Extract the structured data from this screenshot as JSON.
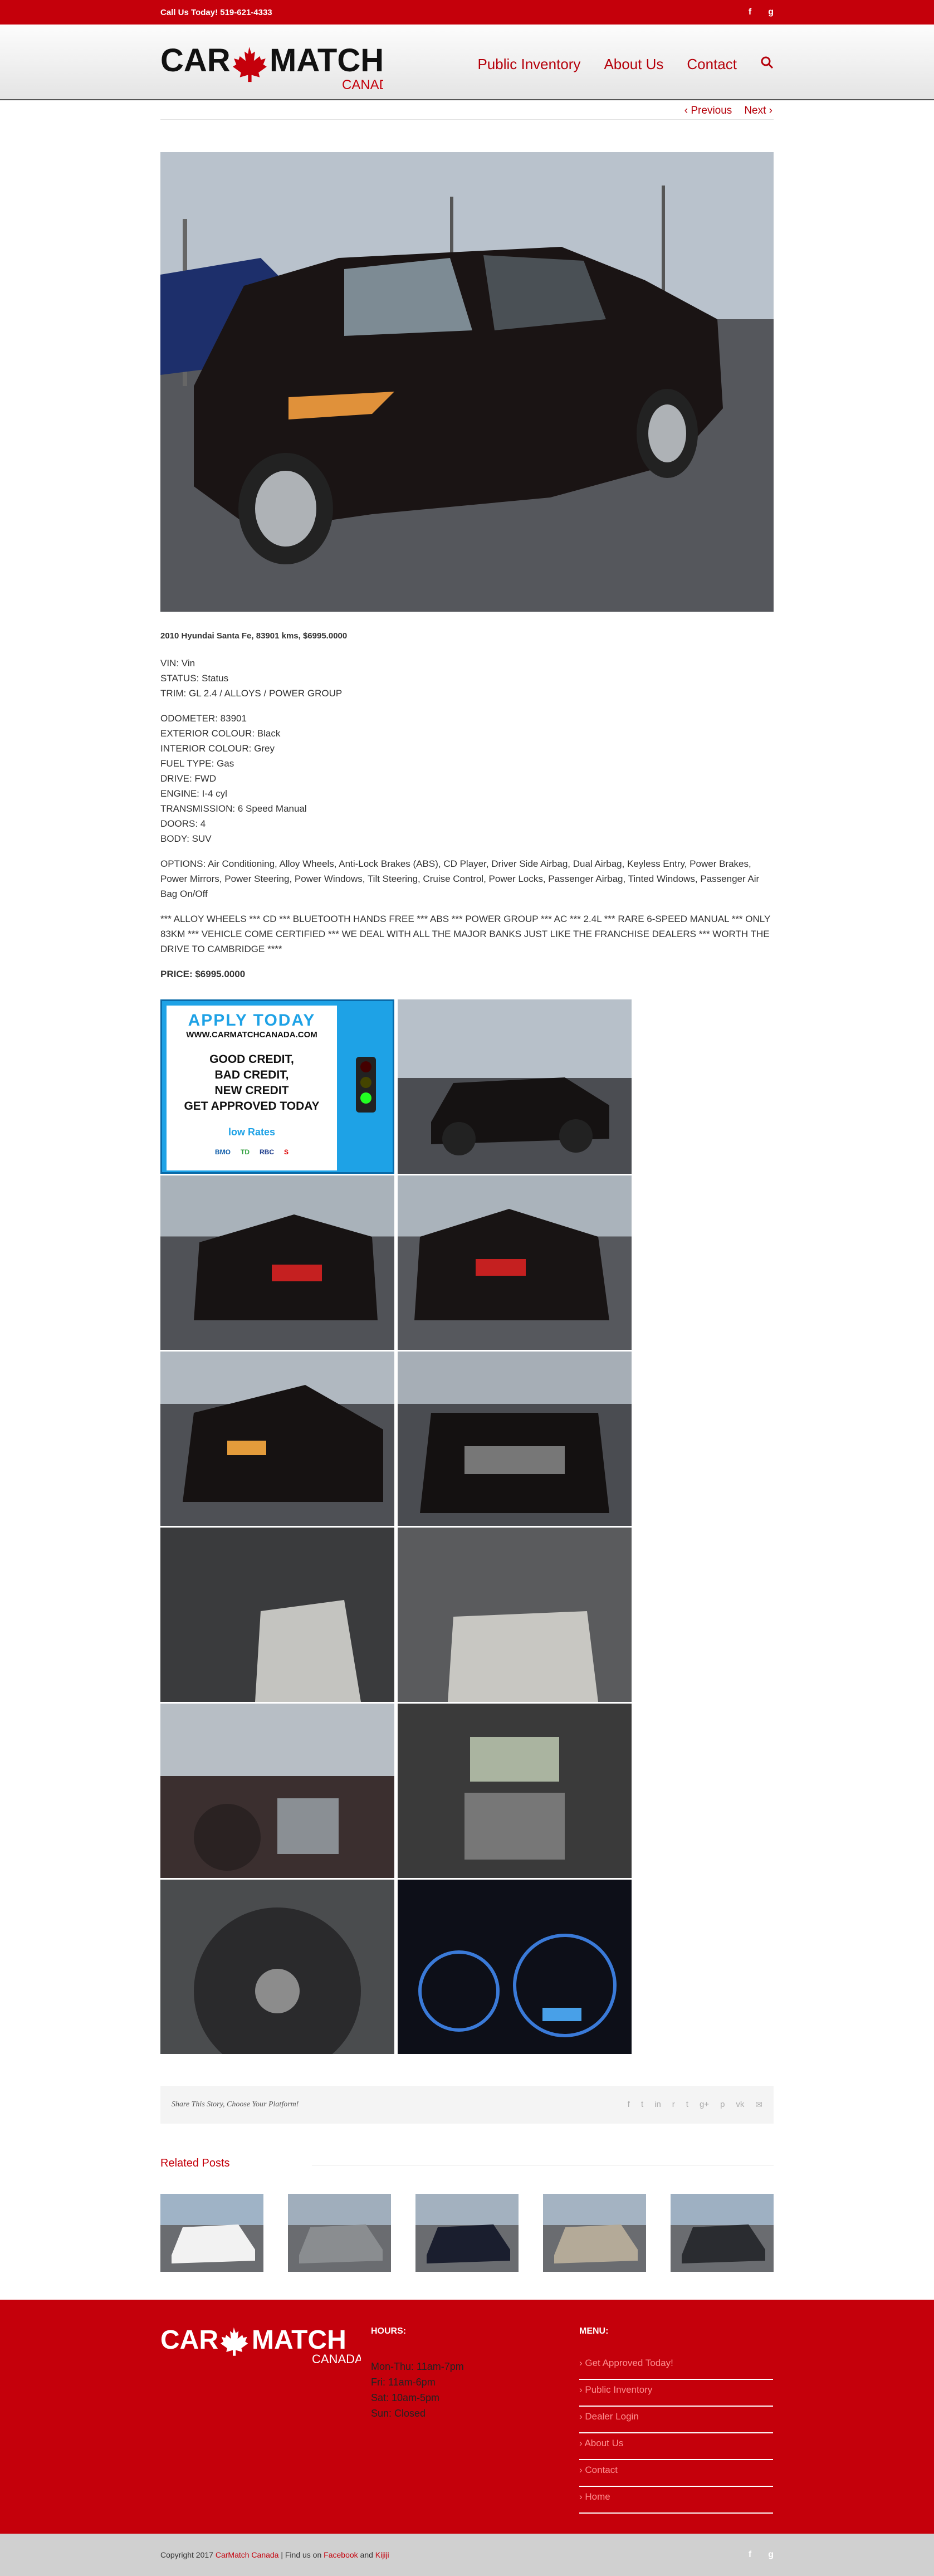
{
  "topbar": {
    "phone_text": "Call Us Today! 519-621-4333",
    "social": [
      "f",
      "g"
    ]
  },
  "brand": {
    "logo_text_1": "CAR",
    "logo_text_2": "MATCH",
    "logo_sub": "CANADA"
  },
  "nav": {
    "items": [
      "Public Inventory",
      "About Us",
      "Contact"
    ],
    "search_icon": "search-icon"
  },
  "post_nav": {
    "previous": "‹  Previous",
    "next": "Next  ›"
  },
  "vehicle": {
    "heading": "2010 Hyundai Santa Fe, 83901 kms, $6995.0000",
    "vin": "VIN: Vin",
    "status": "STATUS: Status",
    "trim": "TRIM: GL 2.4 / ALLOYS / POWER GROUP",
    "odometer": "ODOMETER: 83901",
    "exterior": "EXTERIOR COLOUR: Black",
    "interior": "INTERIOR COLOUR: Grey",
    "fuel": "FUEL TYPE: Gas",
    "drive": "DRIVE: FWD",
    "engine": "ENGINE: I-4 cyl",
    "transmission": "TRANSMISSION: 6 Speed Manual",
    "doors": "DOORS: 4",
    "body": "BODY: SUV",
    "options": "OPTIONS: Air Conditioning, Alloy Wheels, Anti-Lock Brakes (ABS), CD Player, Driver Side Airbag, Dual Airbag, Keyless Entry, Power Brakes, Power Mirrors, Power Steering, Power Windows, Tilt Steering, Cruise Control, Power Locks, Passenger Airbag, Tinted Windows, Passenger Air Bag On/Off",
    "highlights": "*** ALLOY WHEELS *** CD *** BLUETOOTH HANDS FREE *** ABS *** POWER GROUP *** AC *** 2.4L *** RARE 6-SPEED MANUAL *** ONLY 83KM *** VEHICLE COME CERTIFIED *** WE DEAL WITH ALL THE MAJOR BANKS JUST LIKE THE FRANCHISE DEALERS *** WORTH THE DRIVE TO CAMBRIDGE ****",
    "price": "PRICE: $6995.0000"
  },
  "apply_ad": {
    "headline": "APPLY TODAY",
    "url": "WWW.CARMATCHCANADA.COM",
    "lines": [
      "GOOD CREDIT,",
      "BAD CREDIT,",
      "NEW CREDIT",
      "GET APPROVED TODAY"
    ],
    "rates": "low Rates",
    "banks": [
      "BMO",
      "TD",
      "RBC",
      "S"
    ]
  },
  "gallery": {
    "photos": [
      "side-left",
      "rear-left",
      "rear-right",
      "front-left",
      "front",
      "dashboard-driver",
      "rear-seats",
      "dashboard-passenger",
      "center-console",
      "steering-wheel",
      "gauges"
    ]
  },
  "share": {
    "label": "Share This Story, Choose Your Platform!",
    "icons": [
      "f",
      "t",
      "in",
      "r",
      "t",
      "g+",
      "p",
      "vk",
      "✉"
    ]
  },
  "related": {
    "title": "Related Posts",
    "count": 5
  },
  "footer": {
    "hours_title": "HOURS:",
    "hours": [
      "Mon-Thu: 11am-7pm",
      "Fri: 11am-6pm",
      "Sat: 10am-5pm",
      "Sun: Closed"
    ],
    "menu_title": "MENU:",
    "menu": [
      "› Get Approved Today!",
      "› Public Inventory",
      "› Dealer Login",
      "› About Us",
      "› Contact",
      "› Home"
    ]
  },
  "bottom": {
    "copyright_prefix": "Copyright 2017",
    "brand_link": "CarMatch Canada",
    "middle": " | Find us on ",
    "facebook": "Facebook",
    "and": " and ",
    "kijiji": "Kijiji"
  },
  "colors": {
    "brand_red": "#c5000b",
    "apply_blue": "#1ea2e6"
  }
}
